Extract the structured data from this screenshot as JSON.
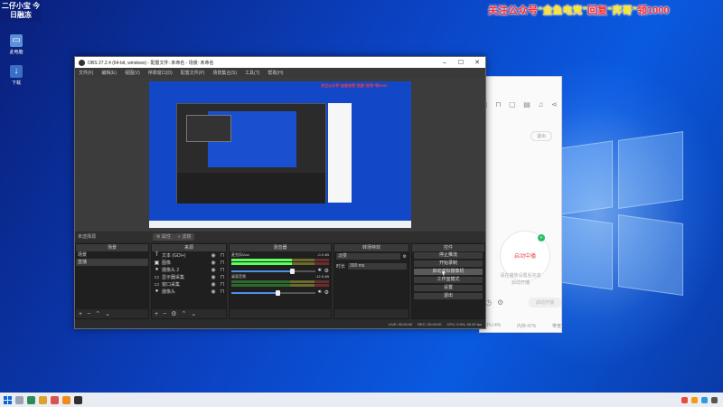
{
  "overlay": {
    "stream_tag": "二仔小宝 今日融冻",
    "promo_prefix": "关注公众号",
    "promo_name": "“金鱼电竞”",
    "promo_mid": "回复",
    "promo_key": "“弈哥”",
    "promo_suffix": "领1000"
  },
  "desktop": {
    "icons": [
      {
        "label": "此电脑",
        "icon": "computer-icon",
        "color": "#5b8fd8"
      },
      {
        "label": "下载",
        "icon": "download-icon",
        "color": "#3a6fc6"
      }
    ]
  },
  "obs": {
    "title": "OBS 27.2.4 (64-bit, windows) - 配置文件: 未命名 - 场景: 未命名",
    "menu": [
      "文件(F)",
      "编辑(E)",
      "视图(V)",
      "停靠窗口(D)",
      "配置文件(P)",
      "场景集合(S)",
      "工具(T)",
      "帮助(H)"
    ],
    "no_source_selected": "未选择源",
    "props_btn": "属性",
    "filters_btn": "滤镜",
    "docks": {
      "scenes": {
        "title": "场景",
        "items": [
          "场景",
          "直播"
        ],
        "active_index": 1
      },
      "sources": {
        "title": "来源",
        "items": [
          {
            "icon": "text-icon",
            "glyph": "T",
            "name": "文本 (GDI+)"
          },
          {
            "icon": "image-icon",
            "glyph": "▣",
            "name": "图像"
          },
          {
            "icon": "camera-icon",
            "glyph": "●",
            "name": "摄像头 2"
          },
          {
            "icon": "monitor-icon",
            "glyph": "▭",
            "name": "显示器采集"
          },
          {
            "icon": "window-icon",
            "glyph": "▭",
            "name": "窗口采集"
          },
          {
            "icon": "camera-icon",
            "glyph": "●",
            "name": "摄像头"
          }
        ]
      },
      "mixer": {
        "title": "混音器",
        "channels": [
          {
            "name": "麦克风/Aux",
            "db": "-0.0 dB",
            "level": 0.62,
            "volume": 0.72
          },
          {
            "name": "桌面音频",
            "db": "-12.8 dB",
            "level": 0.0,
            "volume": 0.55
          }
        ]
      },
      "transitions": {
        "title": "转场特效",
        "type": "淡变",
        "duration_label": "时长",
        "duration_value": "300 ms"
      },
      "controls": {
        "title": "控件",
        "buttons": [
          "停止推流",
          "开始录制",
          "启动虚拟摄像机",
          "工作室模式",
          "设置",
          "退出"
        ],
        "hover_index": 2
      }
    },
    "status": {
      "live": "LIVE: 00:00:00",
      "rec": "REC: 00:00:00",
      "cpu": "CPU: 0.9%, 30.00 fps"
    }
  },
  "side_app": {
    "logout": "退出",
    "status": "启动中播",
    "hint_1": "请在播放设置后完成",
    "hint_2": "启动开播",
    "action_btn": "启动开播",
    "cpu": "CPU:4%",
    "mem": "内存:47%",
    "net": "带宽"
  }
}
